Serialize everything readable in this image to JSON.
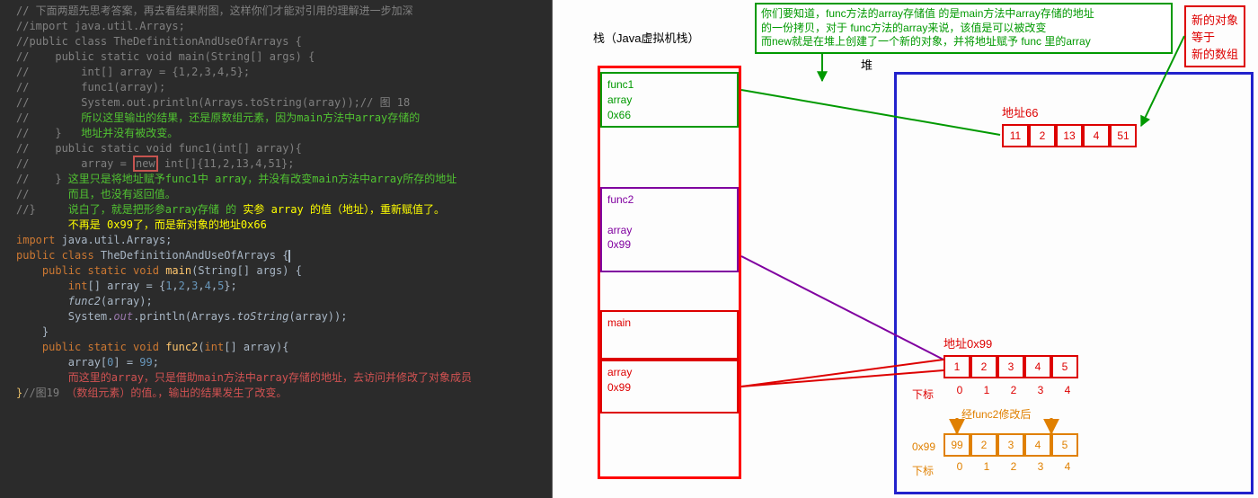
{
  "editor": {
    "lines": [
      {
        "cls": "c-grey",
        "txt": "// 下面两题先思考答案，再去看结果附图，这样你们才能对引用的理解进一步加深"
      },
      {
        "cls": "c-grey",
        "txt": "//import java.util.Arrays;"
      },
      {
        "cls": "c-grey",
        "txt": "//public class TheDefinitionAndUseOfArrays {"
      },
      {
        "cls": "c-grey",
        "txt": "//    public static void main(String[] args) {"
      },
      {
        "cls": "c-grey",
        "txt": "//        int[] array = {1,2,3,4,5};"
      },
      {
        "cls": "c-grey",
        "txt": "//        func1(array);"
      },
      {
        "cls": "c-grey",
        "txt": "//        System.out.println(Arrays.toString(array));// 图 18"
      },
      {
        "html": "<span class='c-grey'>//        </span><span class='c-brightgreen'>所以这里输出的结果，还是原数组元素，因为main方法中array存储的</span>"
      },
      {
        "html": "<span class='c-grey'>//    }   </span><span class='c-brightgreen'>地址并没有被改变。</span>"
      },
      {
        "html": "<span class='c-grey'>//    public static void func1(int[] array){</span>"
      },
      {
        "html": "<span class='c-grey'>//        array = </span><span class='newbox c-grey'>new</span><span class='c-grey'> int[]{11,2,13,4,51};</span>"
      },
      {
        "html": "<span class='c-grey'>//    } </span><span class='c-brightgreen'>这里只是将地址赋予func1中 array，并没有改变main方法中array所存的地址</span>"
      },
      {
        "html": "<span class='c-grey'>//      </span><span class='c-brightgreen'>而且，也没有返回值。</span>"
      },
      {
        "html": "<span class='c-grey'>//}     </span><span class='c-brightgreen'>说白了，就是把形参array存储 的</span><span class='c-cmtyel'> 实参 array 的值（地址），重新赋值了。</span>"
      },
      {
        "html": "<span class='c-grey'>        </span><span class='c-cmtyel'>不再是 0x99了，而是新对象的地址0x66</span>"
      },
      {
        "html": "<span class='c-orange'>import </span><span class='c-white'>java.util.Arrays;</span>"
      },
      {
        "html": "<span class='c-orange'>public class </span><span class='c-white'>TheDefinitionAndUseOfArrays </span><span class='c-white'>{</span><span class='caret'></span>"
      },
      {
        "html": "    <span class='c-orange'>public static void </span><span class='c-yellow'>main</span><span class='c-white'>(String[] args) {</span>"
      },
      {
        "html": "        <span class='c-orange'>int</span><span class='c-white'>[] array = {</span><span class='c-num'>1</span><span class='c-white'>,</span><span class='c-num'>2</span><span class='c-white'>,</span><span class='c-num'>3</span><span class='c-white'>,</span><span class='c-num'>4</span><span class='c-white'>,</span><span class='c-num'>5</span><span class='c-white'>};</span>"
      },
      {
        "html": "        <span class='c-white' style='font-style:italic'>func2</span><span class='c-white'>(array);</span>"
      },
      {
        "html": "        <span class='c-white'>System.</span><span class='c-purple' style='font-style:italic'>out</span><span class='c-white'>.println(Arrays.</span><span class='c-white' style='font-style:italic'>toString</span><span class='c-white'>(array));</span>"
      },
      {
        "html": "    <span class='c-white'>}</span>"
      },
      {
        "html": "    <span class='c-orange'>public static void </span><span class='c-yellow'>func2</span><span class='c-white'>(</span><span class='c-orange'>int</span><span class='c-white'>[] array){</span>"
      },
      {
        "html": "        <span class='c-white'>array[</span><span class='c-num'>0</span><span class='c-white'>] = </span><span class='c-num'>99</span><span class='c-white'>;</span>"
      },
      {
        "html": "        <span class='c-cmtred'>而这里的array，只是借助main方法中array存储的地址，去访问并修改了对象成员</span>"
      },
      {
        "html": "<span class='c-yellow2'>}</span><span class='c-grey'>//图19 </span><span class='c-cmtred'>（数组元素）的值。，输出的结果发生了改变。</span>"
      }
    ]
  },
  "diagram": {
    "stackTitle": "栈（Java虚拟机栈）",
    "heapTitle": "堆",
    "note1_l1": "你们要知道，func方法的array存储值 的是main方法中array存储的地址",
    "note1_l2": "的一份拷贝，对于 func方法的array来说，该值是可以被改变",
    "note1_l3": "而new就是在堆上创建了一个新的对象，并将地址赋予 func 里的array",
    "note2_l1": "新的对象",
    "note2_l2": "    等于",
    "note2_l3": "新的数组",
    "frame1": {
      "name": "func1",
      "var": "array",
      "addr": "0x66"
    },
    "frame2": {
      "name": "func2",
      "var": "array",
      "addr": "0x99"
    },
    "frame3": {
      "name": "main"
    },
    "frame4": {
      "var": "array",
      "addr": "0x99"
    },
    "addr66": "地址66",
    "arr66": [
      "11",
      "2",
      "13",
      "4",
      "51"
    ],
    "addr99": "地址0x99",
    "arr99": [
      "1",
      "2",
      "3",
      "4",
      "5"
    ],
    "idxLabel": "下标",
    "idx": [
      "0",
      "1",
      "2",
      "3",
      "4"
    ],
    "after": "经func2修改后",
    "addr99b": "0x99",
    "arr99b": [
      "99",
      "2",
      "3",
      "4",
      "5"
    ]
  }
}
